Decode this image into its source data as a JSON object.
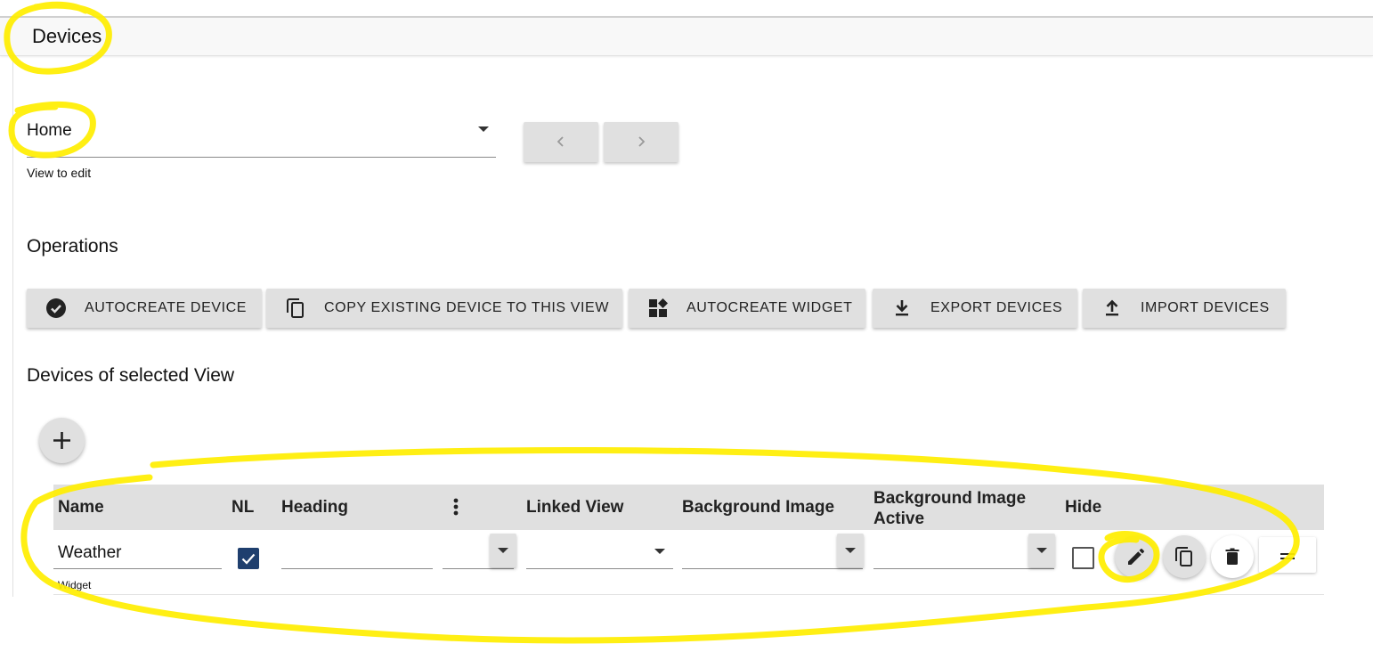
{
  "header": {
    "title": "Devices"
  },
  "view_select": {
    "value": "Home",
    "helper": "View to edit"
  },
  "nav": {
    "prev_icon": "chevron-left-icon",
    "next_icon": "chevron-right-icon"
  },
  "operations": {
    "heading": "Operations",
    "buttons": [
      {
        "label": "AUTOCREATE DEVICE",
        "icon": "check-circle-icon"
      },
      {
        "label": "COPY EXISTING DEVICE TO THIS VIEW",
        "icon": "copy-icon"
      },
      {
        "label": "AUTOCREATE WIDGET",
        "icon": "widgets-icon"
      },
      {
        "label": "EXPORT DEVICES",
        "icon": "download-icon"
      },
      {
        "label": "IMPORT DEVICES",
        "icon": "upload-icon"
      }
    ]
  },
  "devices": {
    "heading": "Devices of selected View",
    "add_icon": "plus-icon",
    "columns": [
      "Name",
      "NL",
      "Heading",
      "Linked View",
      "Background Image",
      "Background Image Active",
      "Hide"
    ],
    "column_menu_icon": "more-vert-icon",
    "rows": [
      {
        "name": "Weather",
        "type_label": "Widget",
        "nl": true,
        "heading": "",
        "linked_view": "",
        "background_image": "",
        "background_image_active": "",
        "hide": false,
        "actions": [
          "edit-icon",
          "copy-icon",
          "delete-icon",
          "drag-handle-icon"
        ]
      }
    ]
  },
  "colors": {
    "accent": "#1f3f6e",
    "annotation": "#ffee00",
    "button_bg": "#e0e0e0"
  }
}
